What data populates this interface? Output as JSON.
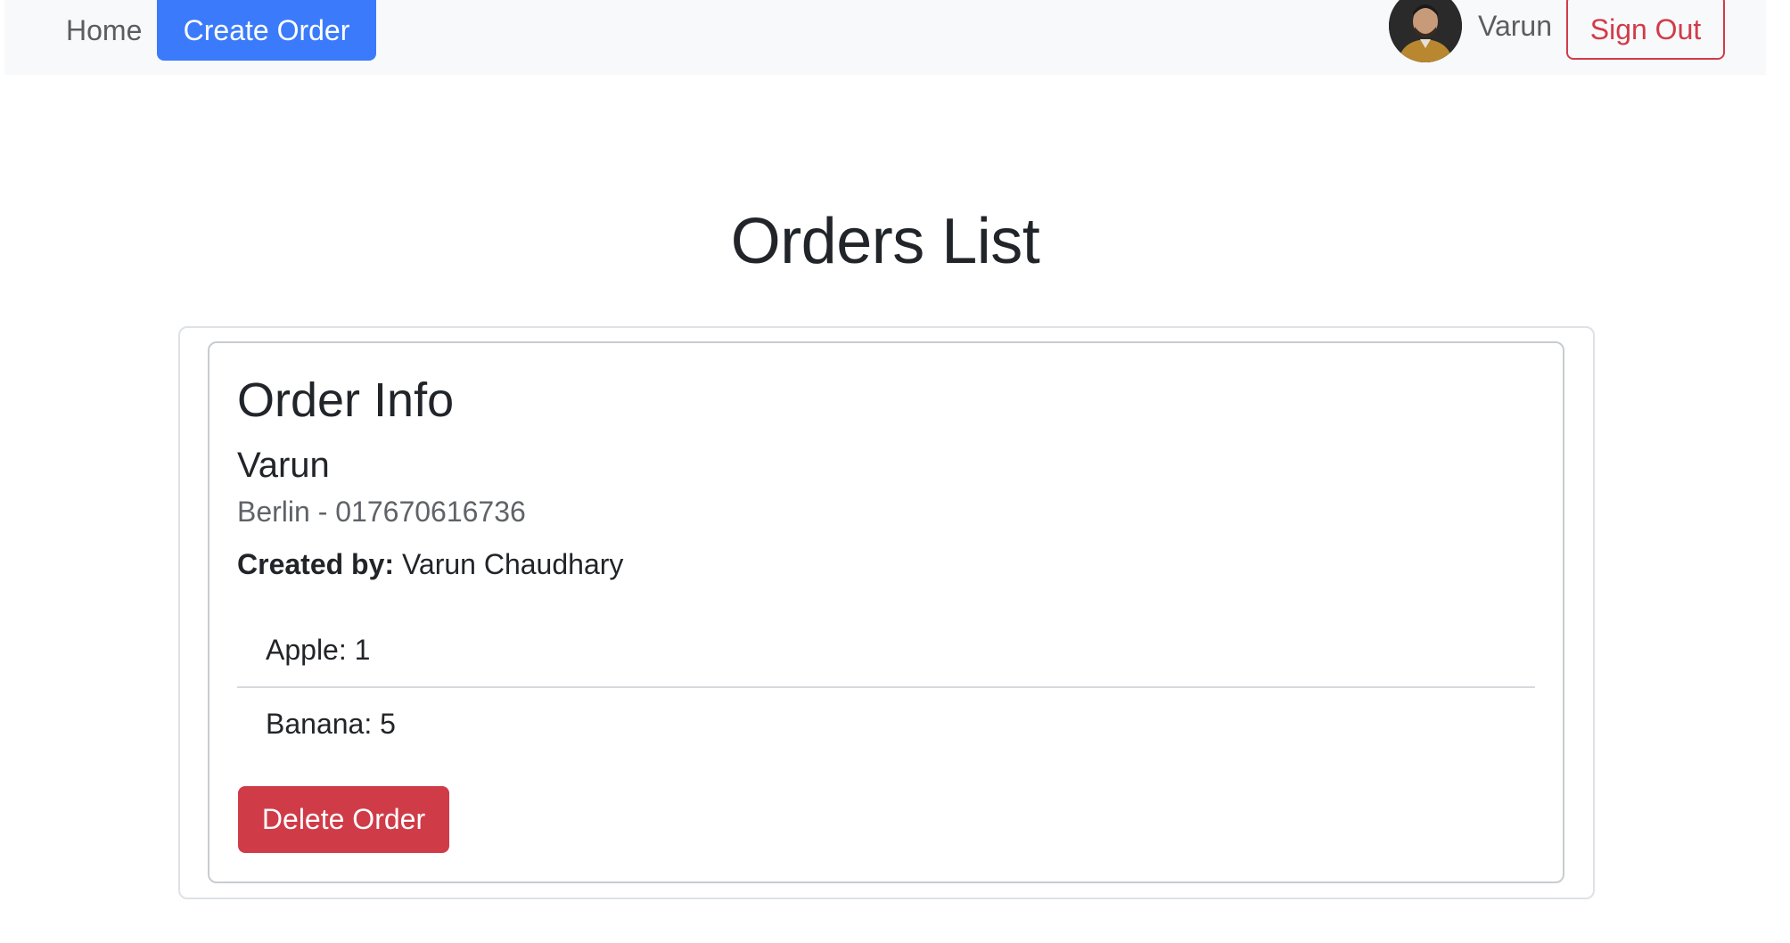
{
  "navbar": {
    "home_label": "Home",
    "create_order_label": "Create Order",
    "user_name": "Varun",
    "sign_out_label": "Sign Out",
    "active_color": "#3b7bfb"
  },
  "page": {
    "title": "Orders List"
  },
  "order": {
    "card_title": "Order Info",
    "customer_name": "Varun",
    "customer_details": "Berlin - 017670616736",
    "created_by_label": "Created by:",
    "created_by_value": "Varun Chaudhary",
    "items": [
      {
        "text": "Apple: 1"
      },
      {
        "text": "Banana: 5"
      }
    ],
    "delete_label": "Delete Order",
    "delete_color": "#d03b48"
  }
}
